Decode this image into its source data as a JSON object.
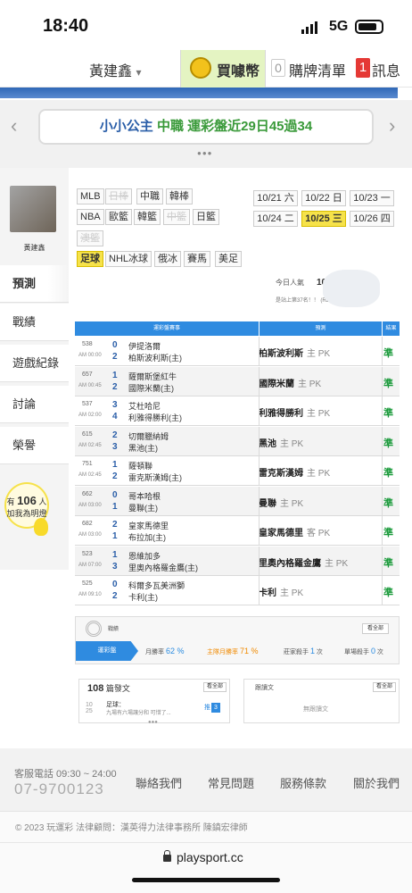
{
  "status": {
    "time": "18:40",
    "network": "5G"
  },
  "topbar": {
    "user": "黃建鑫",
    "user_caret": "▾",
    "coin_label": "買噱幣",
    "cart_count": "0",
    "cart_label": "購牌清單",
    "msg_count": "1",
    "msg_label": "訊息"
  },
  "banner": {
    "name": "小小公主",
    "league": "中職",
    "text": "運彩盤近29日45過34",
    "left": "‹",
    "right": "›",
    "dots": "●●●"
  },
  "sidebar": {
    "name": "黃建鑫",
    "items": [
      "預測",
      "戰績",
      "遊戲紀錄",
      "討論",
      "榮譽"
    ],
    "fans_pre": "有",
    "fans_count": "106",
    "fans_unit": "人",
    "fans_post": "加我為明燈"
  },
  "tags": [
    {
      "label": "MLB",
      "state": "on"
    },
    {
      "label": "日棒",
      "state": "off"
    },
    {
      "label": "中職",
      "state": "on"
    },
    {
      "label": "韓棒",
      "state": "on"
    },
    {
      "label": "NBA",
      "state": "on"
    },
    {
      "label": "歐籃",
      "state": "on"
    },
    {
      "label": "韓籃",
      "state": "on"
    },
    {
      "label": "中籃",
      "state": "off"
    },
    {
      "label": "日籃",
      "state": "on"
    },
    {
      "label": "澳籃",
      "state": "off"
    },
    {
      "label": "足球",
      "state": "sel"
    },
    {
      "label": "NHL冰球",
      "state": "on"
    },
    {
      "label": "俄冰",
      "state": "on"
    },
    {
      "label": "賽馬",
      "state": "on"
    },
    {
      "label": "美足",
      "state": "on"
    }
  ],
  "dates": [
    {
      "label": "10/21 六",
      "sel": false
    },
    {
      "label": "10/22 日",
      "sel": false
    },
    {
      "label": "10/23 一",
      "sel": false
    },
    {
      "label": "10/24 二",
      "sel": false
    },
    {
      "label": "10/25 三",
      "sel": true
    },
    {
      "label": "10/26 四",
      "sel": false
    }
  ],
  "popularity": {
    "label": "今日人氣",
    "value": "105",
    "rank": "是站上第37名！！ (RE0068)"
  },
  "table": {
    "headers": [
      "運彩盤賽事",
      "預測",
      "結果"
    ]
  },
  "games": [
    {
      "id": "538",
      "time": "AM 00:00",
      "s1": "0",
      "t1": "伊提洛爾",
      "s2": "2",
      "t2": "柏斯波利斯(主)",
      "pick": "柏斯波利斯",
      "side": "主 PK",
      "result": "準"
    },
    {
      "id": "657",
      "time": "AM 00:45",
      "s1": "1",
      "t1": "薩爾斯堡紅牛",
      "s2": "2",
      "t2": "國際米蘭(主)",
      "pick": "國際米蘭",
      "side": "主 PK",
      "result": "準"
    },
    {
      "id": "537",
      "time": "AM 02:00",
      "s1": "3",
      "t1": "艾杜哈尼",
      "s2": "4",
      "t2": "利雅得勝利(主)",
      "pick": "利雅得勝利",
      "side": "主 PK",
      "result": "準"
    },
    {
      "id": "615",
      "time": "AM 02:45",
      "s1": "2",
      "t1": "切爾臘納姆",
      "s2": "3",
      "t2": "黑池(主)",
      "pick": "黑池",
      "side": "主 PK",
      "result": "準"
    },
    {
      "id": "751",
      "time": "AM 02:45",
      "s1": "1",
      "t1": "薩頓聯",
      "s2": "2",
      "t2": "雷克斯漢姆(主)",
      "pick": "雷克斯漢姆",
      "side": "主 PK",
      "result": "準"
    },
    {
      "id": "662",
      "time": "AM 03:00",
      "s1": "0",
      "t1": "哥本哈根",
      "s2": "1",
      "t2": "曼聯(主)",
      "pick": "曼聯",
      "side": "主 PK",
      "result": "準"
    },
    {
      "id": "682",
      "time": "AM 03:00",
      "s1": "2",
      "t1": "皇家馬德里",
      "s2": "1",
      "t2": "布拉加(主)",
      "pick": "皇家馬德里",
      "side": "客 PK",
      "result": "準"
    },
    {
      "id": "523",
      "time": "AM 07:00",
      "s1": "1",
      "t1": "恩維加多",
      "s2": "3",
      "t2": "里奧內格羅金鷹(主)",
      "pick": "里奧內格羅金鷹",
      "side": "主 PK",
      "result": "準"
    },
    {
      "id": "525",
      "time": "AM 09:10",
      "s1": "0",
      "t1": "科爾多瓦美洲獅",
      "s2": "2",
      "t2": "卡利(主)",
      "pick": "卡利",
      "side": "主 PK",
      "result": "準"
    }
  ],
  "stats": {
    "label": "戰績",
    "more": "看全部",
    "tab": "運彩盤",
    "monthly_label": "月勝率",
    "monthly": "62 %",
    "home_label": "主隊月勝率",
    "home": "71 %",
    "killer_label": "莊家殺手",
    "killer": "1",
    "killer_unit": "次",
    "single_label": "單場殺手",
    "single": "0",
    "single_unit": "次"
  },
  "articles": {
    "count": "108",
    "label": "篇發文",
    "more": "看全部",
    "date": "10",
    "date2": "25",
    "title": "足球：",
    "sub": "九場有六場讓分和 可惜了...",
    "pk": "推",
    "badge": "3"
  },
  "following": {
    "label": "跟讀文",
    "more": "看全部",
    "none": "無跟讀文"
  },
  "footer": {
    "service_label": "客服電話 09:30 ~ 24:00",
    "phone": "07-9700123",
    "links": [
      "聯絡我們",
      "常見問題",
      "服務條款",
      "關於我們"
    ],
    "copyright": "© 2023 玩運彩 法律顧問：漢英得力法律事務所 陳鎮宏律師"
  },
  "browser": {
    "url": "playsport.cc"
  }
}
